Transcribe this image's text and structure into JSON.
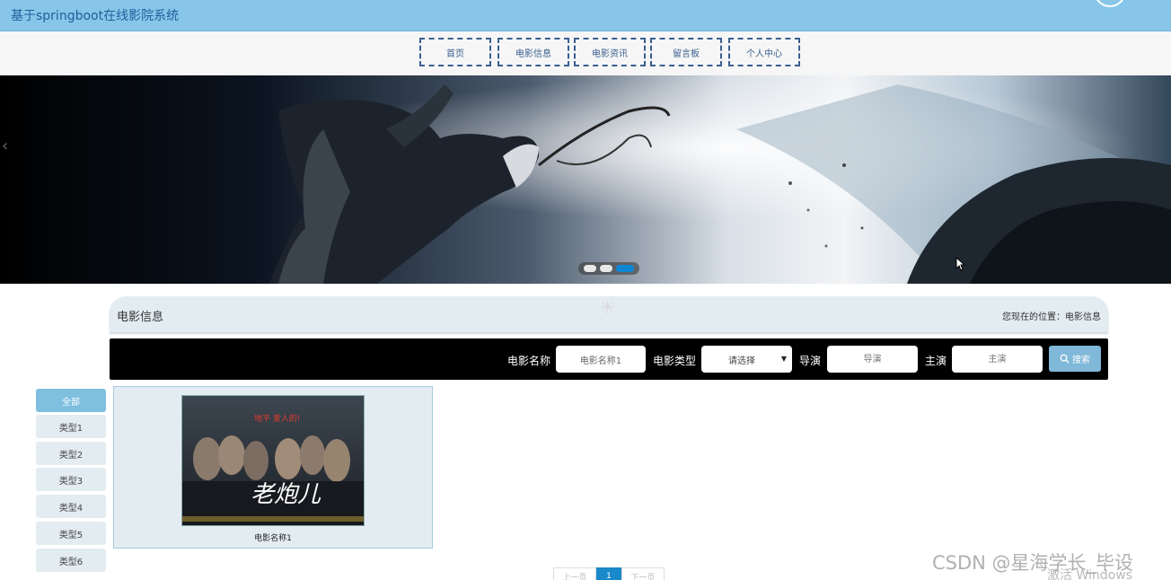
{
  "header": {
    "title": "基于springboot在线影院系统"
  },
  "nav": {
    "items": [
      {
        "label": "首页"
      },
      {
        "label": "电影信息"
      },
      {
        "label": "电影资讯"
      },
      {
        "label": "留言板"
      },
      {
        "label": "个人中心"
      }
    ]
  },
  "banner": {
    "prev_arrow": "‹",
    "slide_count": 3,
    "active_slide": 3
  },
  "page": {
    "heading": "电影信息",
    "location": "您现在的位置：电影信息",
    "loading_glyph": "✳"
  },
  "search": {
    "name_label": "电影名称",
    "name_value": "电影名称1",
    "type_label": "电影类型",
    "type_value": "请选择",
    "director_label": "导演",
    "director_placeholder": "导演",
    "actor_label": "主演",
    "actor_placeholder": "主演",
    "button_label": "搜索"
  },
  "categories": [
    {
      "label": "全部",
      "active": true
    },
    {
      "label": "类型1"
    },
    {
      "label": "类型2"
    },
    {
      "label": "类型3"
    },
    {
      "label": "类型4"
    },
    {
      "label": "类型5"
    },
    {
      "label": "类型6"
    }
  ],
  "movies": [
    {
      "name": "电影名称1",
      "poster_title": "老炮儿",
      "poster_tagline": "地平 爱人的!"
    }
  ],
  "pagination": {
    "prev": "上一页",
    "current": "1",
    "next": "下一页"
  },
  "watermarks": {
    "csdn": "CSDN @星海学长_毕设",
    "windows": "激活 Windows"
  },
  "colors": {
    "topbar": "#87c6e9",
    "accent": "#1989c9",
    "panel": "#e3ecf1",
    "category_active": "#7fbfe0",
    "search_button": "#7fb8d9"
  }
}
